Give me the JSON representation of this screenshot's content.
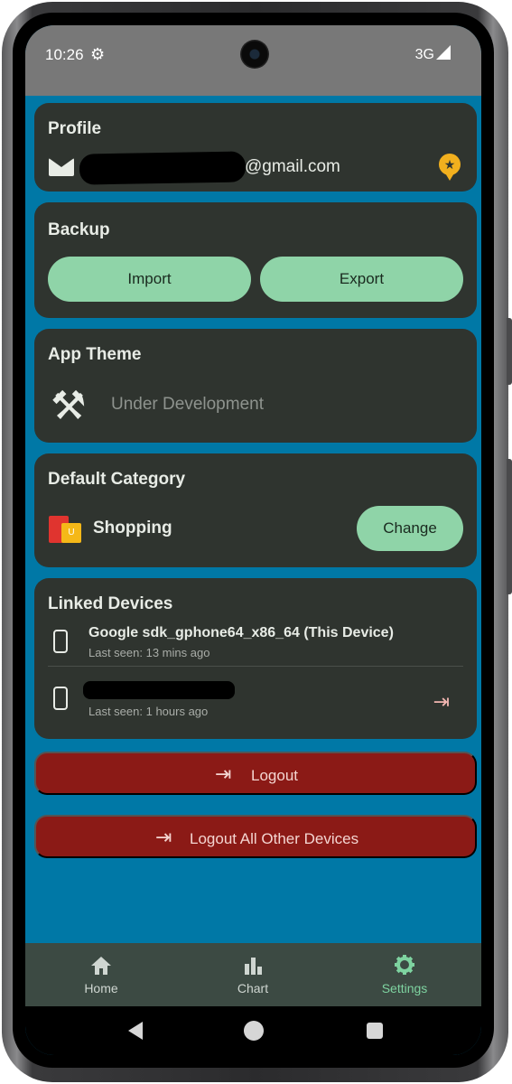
{
  "statusbar": {
    "time": "10:26",
    "network": "3G"
  },
  "profile": {
    "title": "Profile",
    "email_domain": "@gmail.com"
  },
  "backup": {
    "title": "Backup",
    "import_label": "Import",
    "export_label": "Export"
  },
  "theme": {
    "title": "App Theme",
    "status_text": "Under Development"
  },
  "category": {
    "title": "Default Category",
    "selected": "Shopping",
    "change_label": "Change"
  },
  "devices": {
    "title": "Linked Devices",
    "items": [
      {
        "name": "Google sdk_gphone64_x86_64 (This Device)",
        "last_seen": "Last seen: 13 mins ago"
      },
      {
        "name": "",
        "last_seen": "Last seen: 1 hours ago"
      }
    ]
  },
  "actions": {
    "logout_label": "Logout",
    "logout_all_label": "Logout All Other Devices"
  },
  "nav": {
    "items": [
      {
        "label": "Home"
      },
      {
        "label": "Chart"
      },
      {
        "label": "Settings"
      }
    ]
  },
  "colors": {
    "background": "#0078a6",
    "card": "#2f342f",
    "accent_green": "#8fd4a8",
    "danger_red": "#8b1a16",
    "nav_active": "#7ed3a0"
  }
}
